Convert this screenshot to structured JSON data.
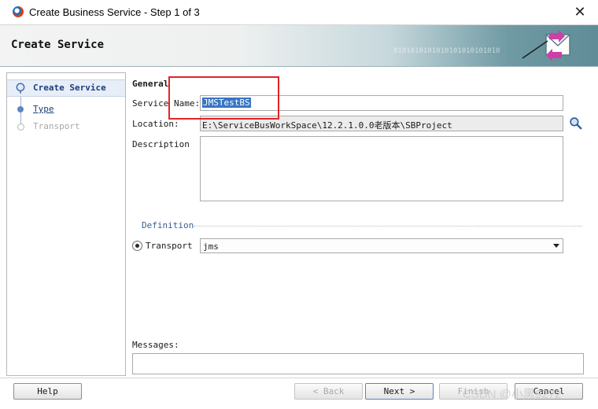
{
  "window": {
    "title": "Create Business Service - Step 1 of 3",
    "close_glyph": "✕"
  },
  "banner": {
    "title": "Create Service",
    "binary_text": "0101010101010101010101010"
  },
  "steps": [
    {
      "label": "Create Service",
      "state": "active"
    },
    {
      "label": "Type",
      "state": "link"
    },
    {
      "label": "Transport",
      "state": "disabled"
    }
  ],
  "general": {
    "section_label": "General",
    "service_name_label": "Service Name:",
    "service_name_value": "JMSTestBS",
    "location_label": "Location:",
    "location_value": "E:\\ServiceBusWorkSpace\\12.2.1.0.0老版本\\SBProject",
    "description_label": "Description",
    "description_value": ""
  },
  "definition": {
    "section_label": "Definition",
    "transport_label": "Transport",
    "transport_value": "jms"
  },
  "messages": {
    "label": "Messages:",
    "value": ""
  },
  "buttons": {
    "help": "Help",
    "back": "< Back",
    "next": "Next >",
    "finish": "Finish",
    "cancel": "Cancel"
  },
  "watermark": "CSDN @小黑9272",
  "colors": {
    "highlight_box": "#e32424",
    "selection": "#3875c5",
    "link": "#1a3d7c"
  }
}
